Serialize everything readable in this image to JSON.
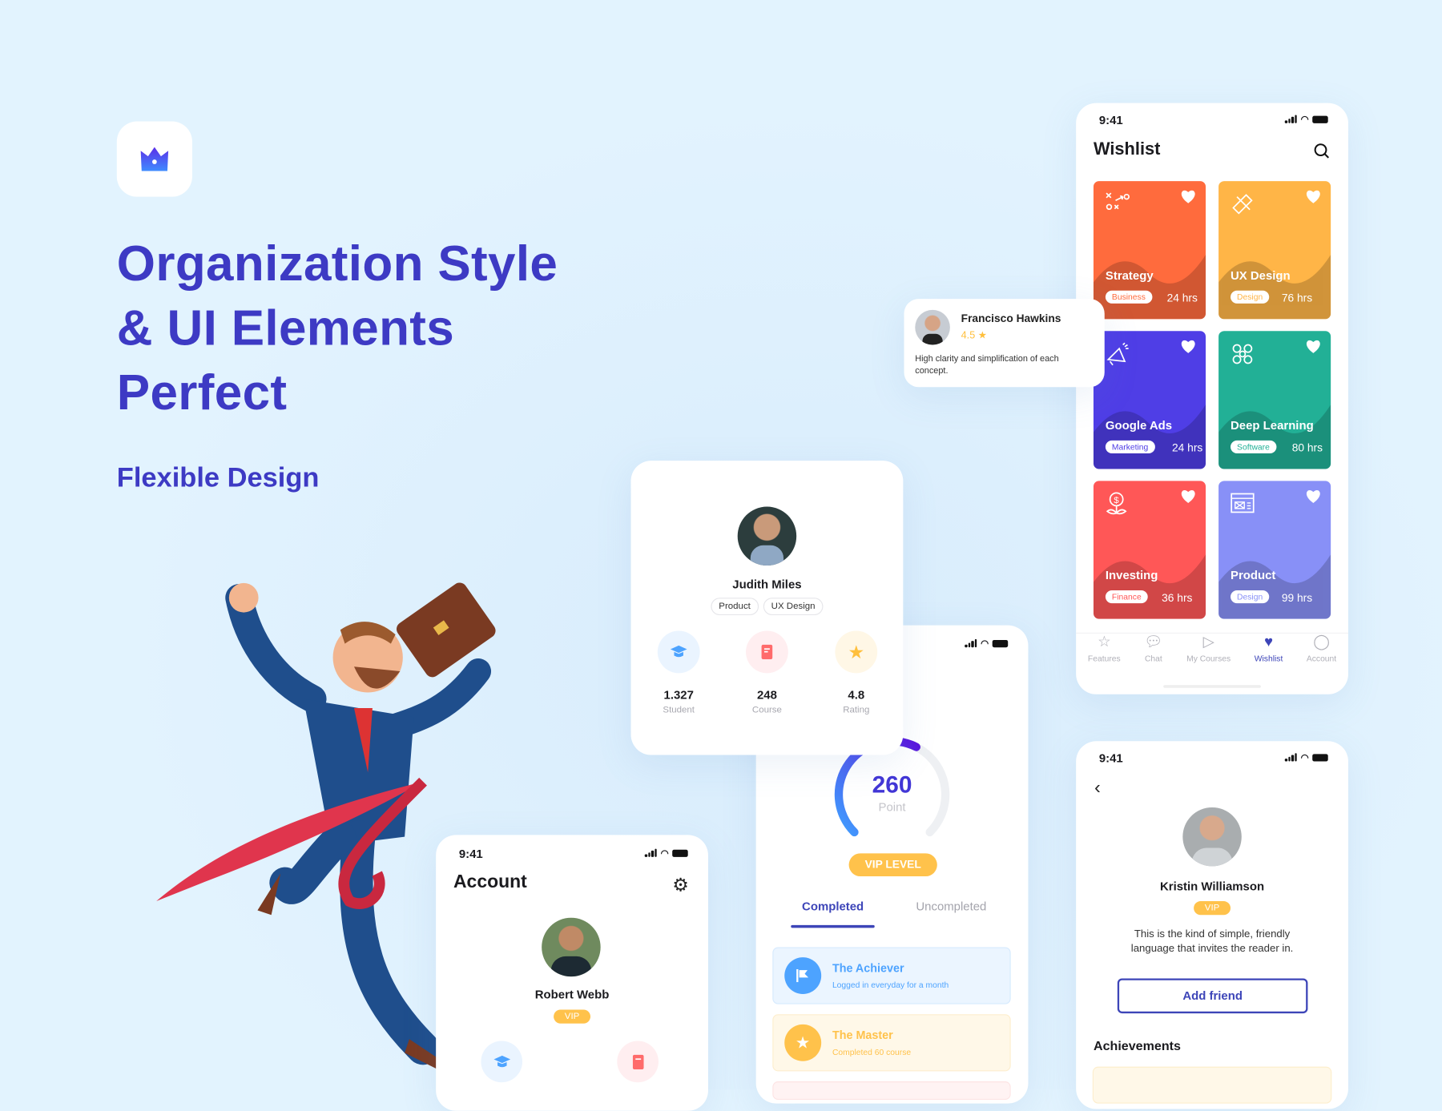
{
  "hero": {
    "title_lines": [
      "Organization Style",
      "& UI Elements",
      "Perfect"
    ],
    "subtitle": "Flexible Design",
    "brand_color": "#3d3ac4",
    "logo_icon": "crown-icon"
  },
  "status_time": "9:41",
  "review": {
    "name": "Francisco Hawkins",
    "rating": "4.5",
    "text": "High clarity and simplification of each concept."
  },
  "profile_card": {
    "name": "Judith Miles",
    "tags": [
      "Product",
      "UX Design"
    ],
    "stats": [
      {
        "value": "1.327",
        "label": "Student",
        "icon": "graduation-cap-icon"
      },
      {
        "value": "248",
        "label": "Course",
        "icon": "book-icon"
      },
      {
        "value": "4.8",
        "label": "Rating",
        "icon": "star-icon"
      }
    ]
  },
  "points": {
    "value": "260",
    "label": "Point",
    "progress": 0.6,
    "level_button": "VIP LEVEL",
    "tabs": [
      "Completed",
      "Uncompleted"
    ],
    "active_tab": "Completed",
    "achievements": [
      {
        "title": "The Achiever",
        "subtitle": "Logged in everyday for a month",
        "color": "#4da3ff",
        "icon": "flag-icon"
      },
      {
        "title": "The Master",
        "subtitle": "Completed 60 course",
        "color": "#ffc24b",
        "icon": "star-icon"
      }
    ]
  },
  "account": {
    "title": "Account",
    "name": "Robert Webb",
    "badge": "VIP"
  },
  "wishlist": {
    "title": "Wishlist",
    "cards": [
      {
        "title": "Strategy",
        "tag": "Business",
        "hours": "24 hrs",
        "color": "#ff6b3d",
        "icon": "strategy-icon"
      },
      {
        "title": "UX Design",
        "tag": "Design",
        "hours": "76 hrs",
        "color": "#ffb547",
        "icon": "ruler-pencil-icon"
      },
      {
        "title": "Google Ads",
        "tag": "Marketing",
        "hours": "24 hrs",
        "color": "#4f3ee6",
        "icon": "megaphone-icon"
      },
      {
        "title": "Deep Learning",
        "tag": "Software",
        "hours": "80 hrs",
        "color": "#22b096",
        "icon": "network-icon"
      },
      {
        "title": "Investing",
        "tag": "Finance",
        "hours": "36 hrs",
        "color": "#ff5757",
        "icon": "money-plant-icon"
      },
      {
        "title": "Product",
        "tag": "Design",
        "hours": "99 hrs",
        "color": "#8890f7",
        "icon": "browser-icon"
      }
    ],
    "tabs": [
      {
        "label": "Features",
        "icon": "star-icon"
      },
      {
        "label": "Chat",
        "icon": "chat-icon"
      },
      {
        "label": "My Courses",
        "icon": "play-icon"
      },
      {
        "label": "Wishlist",
        "icon": "heart-icon"
      },
      {
        "label": "Account",
        "icon": "user-icon"
      }
    ],
    "active_tab": "Wishlist"
  },
  "friend": {
    "name": "Kristin Williamson",
    "badge": "VIP",
    "bio": "This is the kind of simple, friendly language that invites the reader in.",
    "button": "Add friend",
    "section": "Achievements"
  }
}
